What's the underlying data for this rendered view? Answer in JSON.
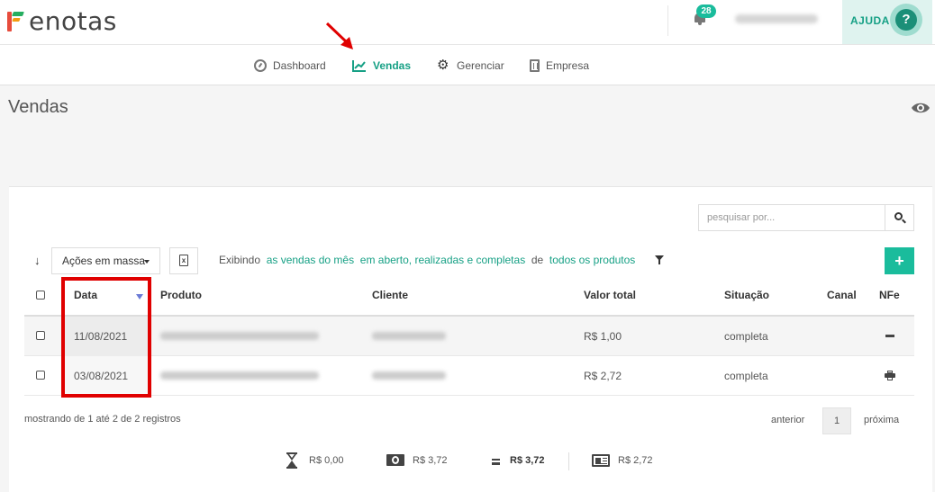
{
  "header": {
    "logo_text": "enotas",
    "notifications_count": "28",
    "help_label": "AJUDA",
    "help_icon_glyph": "?"
  },
  "nav": {
    "items": [
      {
        "label": "Dashboard",
        "icon": "gauge-icon"
      },
      {
        "label": "Vendas",
        "icon": "chart-line-icon",
        "active": true
      },
      {
        "label": "Gerenciar",
        "icon": "gear-icon"
      },
      {
        "label": "Empresa",
        "icon": "building-icon"
      }
    ]
  },
  "page": {
    "title": "Vendas"
  },
  "toolbar": {
    "search_placeholder": "pesquisar por...",
    "bulk_actions_label": "Ações em massa",
    "excel_glyph": "x",
    "add_glyph": "+",
    "filter": {
      "prefix": "Exibindo",
      "period": "as vendas do mês",
      "status": "em aberto, realizadas e completas",
      "connector": "de",
      "products": "todos os produtos"
    }
  },
  "table": {
    "columns": [
      "Data",
      "Produto",
      "Cliente",
      "Valor total",
      "Situação",
      "Canal",
      "NFe"
    ],
    "sorted_column": "Data",
    "rows": [
      {
        "date": "11/08/2021",
        "value": "R$ 1,00",
        "status": "completa",
        "nfe_icon": "minus-icon"
      },
      {
        "date": "03/08/2021",
        "value": "R$ 2,72",
        "status": "completa",
        "nfe_icon": "printer-icon"
      }
    ]
  },
  "pagination": {
    "showing": "mostrando de 1 até 2 de 2 registros",
    "prev": "anterior",
    "current": "1",
    "next": "próxima"
  },
  "totals": {
    "pending": "R$ 0,00",
    "received": "R$ 3,72",
    "total": "R$ 3,72",
    "invoiced": "R$ 2,72"
  },
  "colors": {
    "accent": "#1abc9c",
    "accent_dark": "#16a085",
    "annotation_red": "#e00000"
  }
}
